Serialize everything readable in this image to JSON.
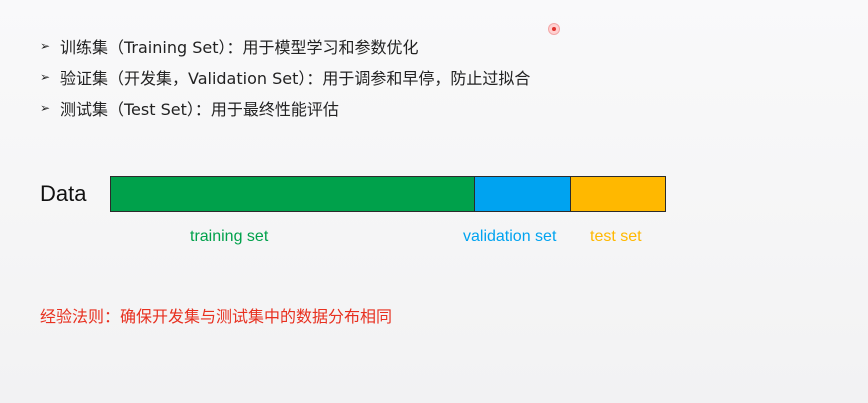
{
  "bullets": [
    {
      "marker": "➢",
      "text": "训练集（Training Set）：用于模型学习和参数优化"
    },
    {
      "marker": "➢",
      "text": "验证集（开发集，Validation Set）：用于调参和早停，防止过拟合"
    },
    {
      "marker": "➢",
      "text": "测试集（Test Set）：用于最终性能评估"
    }
  ],
  "diagram": {
    "data_label": "Data",
    "segments": {
      "training": {
        "label": "training set",
        "color": "#00a14b"
      },
      "validation": {
        "label": "validation set",
        "color": "#00a3f0"
      },
      "test": {
        "label": "test set",
        "color": "#ffb800"
      }
    }
  },
  "rule": {
    "text": "经验法则：确保开发集与测试集中的数据分布相同",
    "color": "#e8301f"
  }
}
